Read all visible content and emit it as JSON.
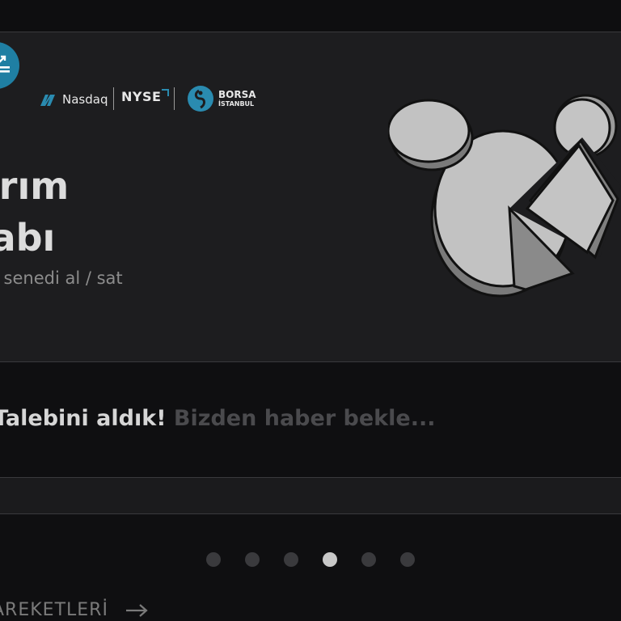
{
  "hero": {
    "exchanges": {
      "nasdaq": "Nasdaq",
      "nyse": "NYSE",
      "borsa_line1": "BORSA",
      "borsa_line2": "İSTANBUL"
    },
    "title_line1": "atırım",
    "title_line2": "esabı",
    "subtitle": "se senedi al / sat"
  },
  "notice": {
    "strong": "Talebini aldık!",
    "muted": "Bizden haber bekle..."
  },
  "carousel": {
    "total_slides": 6,
    "active_index": 3
  },
  "footer": {
    "link_label": "AREKETLERİ"
  },
  "colors": {
    "background": "#0f0f11",
    "card": "#1d1d1f",
    "accent_blue": "#1f7fa3",
    "dot_active": "#c8c8c8",
    "dot_inactive": "#3a3a3d"
  },
  "icons": {
    "app": "chart-up-icon",
    "illustration": "pie-chart-coins-illustration",
    "footer_arrow": "arrow-right-icon"
  }
}
